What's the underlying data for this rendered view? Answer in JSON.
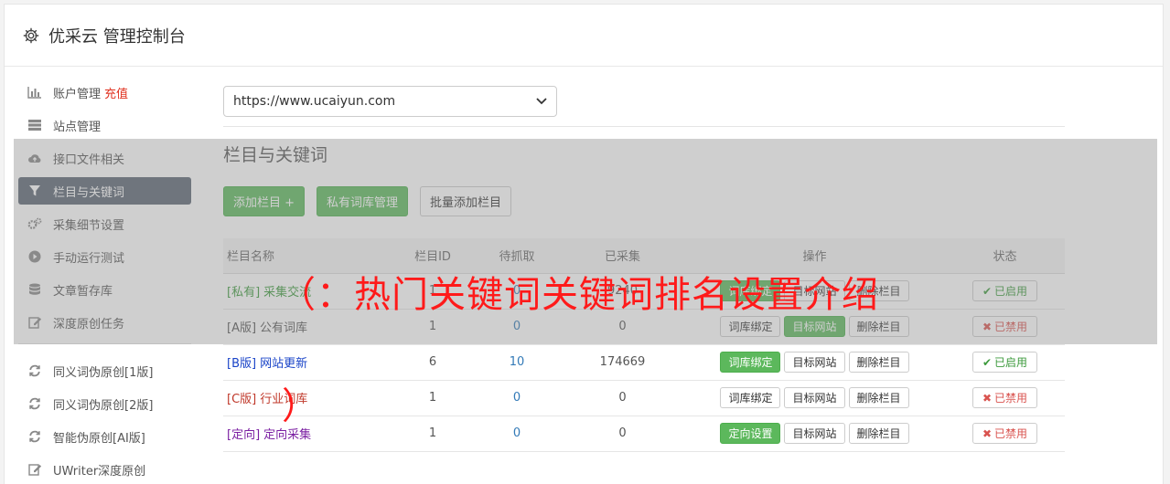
{
  "app": {
    "title": "优采云 管理控制台"
  },
  "sidebar": {
    "items": [
      {
        "label": "账户管理",
        "extra": "充值",
        "icon": "bar-chart-icon"
      },
      {
        "label": "站点管理",
        "icon": "server-icon"
      },
      {
        "label": "接口文件相关",
        "icon": "cloud-upload-icon"
      },
      {
        "label": "栏目与关键词",
        "icon": "filter-icon",
        "active": true
      },
      {
        "label": "采集细节设置",
        "icon": "gears-icon"
      },
      {
        "label": "手动运行测试",
        "icon": "play-circle-icon"
      },
      {
        "label": "文章暂存库",
        "icon": "database-icon"
      },
      {
        "label": "深度原创任务",
        "icon": "edit-icon"
      }
    ],
    "items2": [
      {
        "label": "同义词伪原创[1版]",
        "icon": "refresh-icon"
      },
      {
        "label": "同义词伪原创[2版]",
        "icon": "refresh-icon"
      },
      {
        "label": "智能伪原创[AI版]",
        "icon": "refresh-icon"
      },
      {
        "label": "UWriter深度原创",
        "icon": "edit-icon"
      }
    ]
  },
  "main": {
    "site_select": "https://www.ucaiyun.com",
    "section_title": "栏目与关键词",
    "buttons": {
      "add_column": "添加栏目 +",
      "private_lexicon": "私有词库管理",
      "batch_add": "批量添加栏目"
    },
    "table": {
      "headers": [
        "栏目名称",
        "栏目ID",
        "待抓取",
        "已采集",
        "操作",
        "状态"
      ],
      "rows": [
        {
          "tag": "[私有]",
          "name": "采集交流",
          "id": "1",
          "pending": "0",
          "collected": "9240",
          "op1": "词库绑定",
          "op1_green": true,
          "op2": "目标网站",
          "op2_green": false,
          "op3": "删除栏目",
          "status": "已启用",
          "enabled": true,
          "color": "#3c9a3c"
        },
        {
          "tag": "[A版]",
          "name": "公有词库",
          "id": "1",
          "pending": "0",
          "collected": "0",
          "op1": "词库绑定",
          "op1_green": false,
          "op2": "目标网站",
          "op2_green": true,
          "op3": "删除栏目",
          "status": "已禁用",
          "enabled": false,
          "color": "#555555"
        },
        {
          "tag": "[B版]",
          "name": "网站更新",
          "id": "6",
          "pending": "10",
          "collected": "174669",
          "op1": "词库绑定",
          "op1_green": true,
          "op2": "目标网站",
          "op2_green": false,
          "op3": "删除栏目",
          "status": "已启用",
          "enabled": true,
          "color": "#1a44c8"
        },
        {
          "tag": "[C版]",
          "name": "行业词库",
          "id": "1",
          "pending": "0",
          "collected": "0",
          "op1": "词库绑定",
          "op1_green": false,
          "op2": "目标网站",
          "op2_green": false,
          "op3": "删除栏目",
          "status": "已禁用",
          "enabled": false,
          "color": "#c0392b"
        },
        {
          "tag": "[定向]",
          "name": "定向采集",
          "id": "1",
          "pending": "0",
          "collected": "0",
          "op1": "定向设置",
          "op1_green": true,
          "op2": "目标网站",
          "op2_green": false,
          "op3": "删除栏目",
          "status": "已禁用",
          "enabled": false,
          "color": "#7b1fa2"
        }
      ]
    }
  },
  "overlay": {
    "text": "（：热门关键词关键词排名设置介绍",
    "paren": "）"
  }
}
